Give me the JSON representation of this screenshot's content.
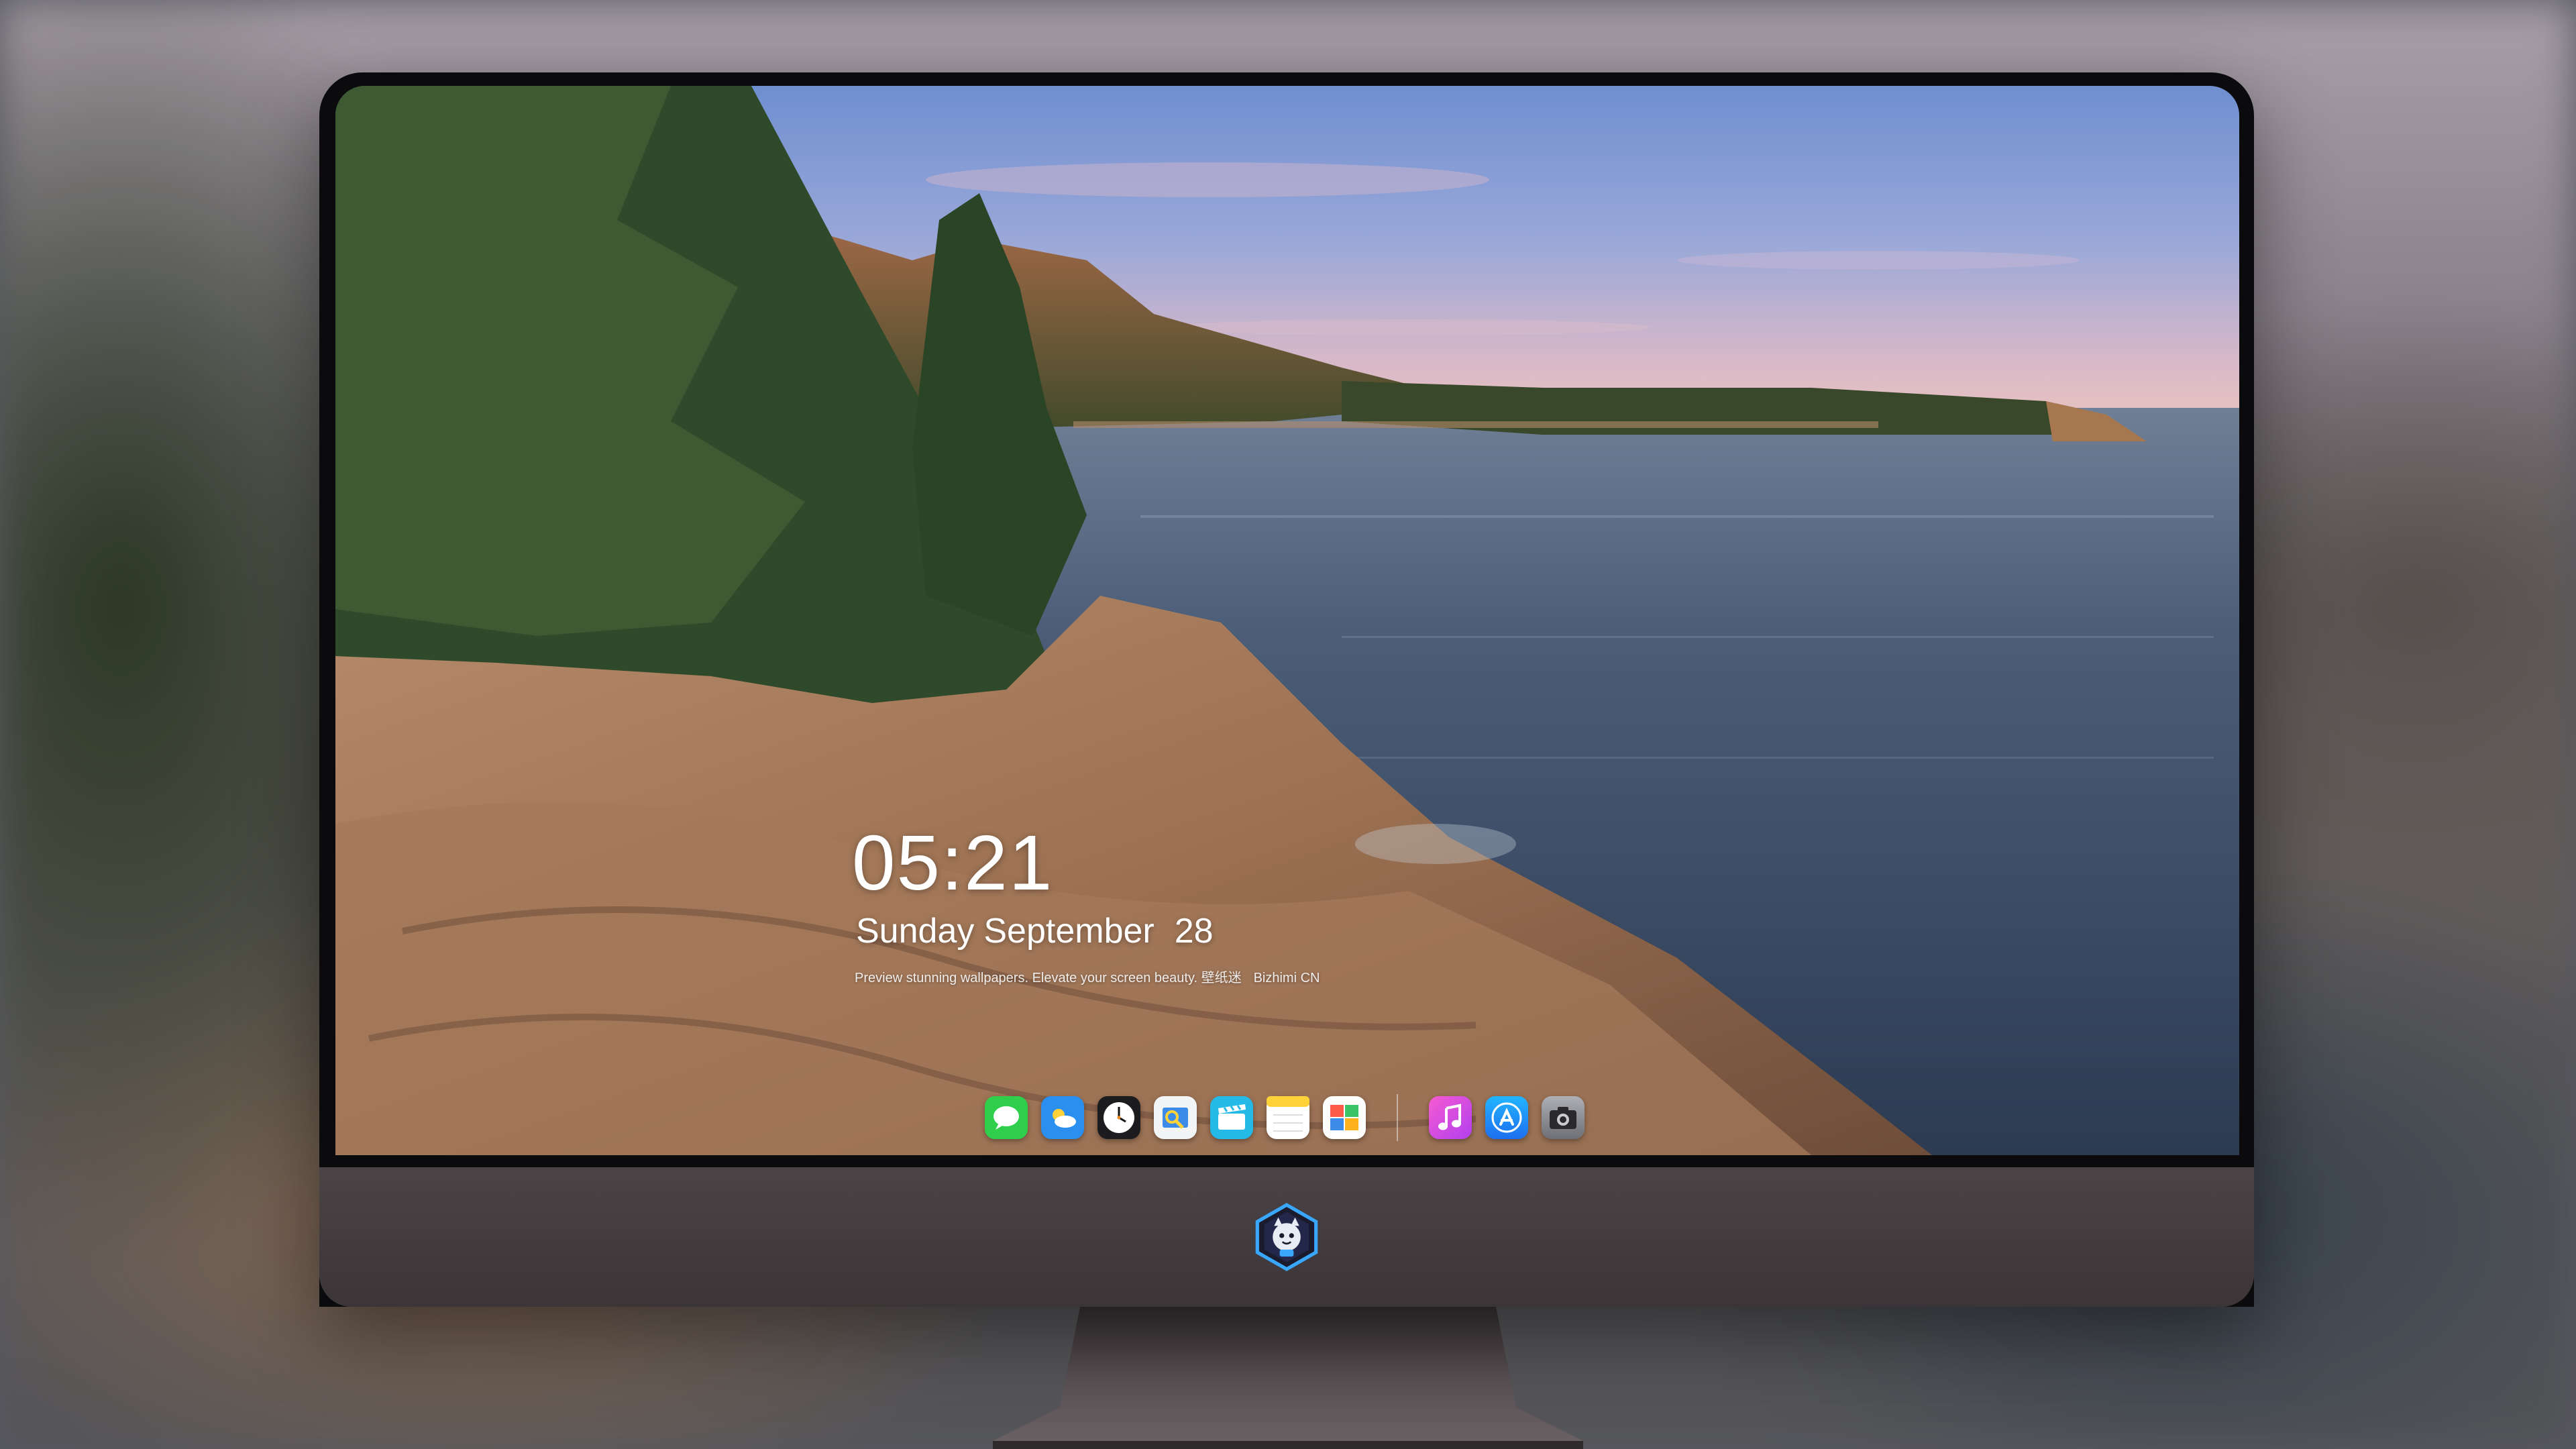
{
  "lock_screen": {
    "time": "05:21",
    "weekday": "Sunday",
    "month": "September",
    "day": "28",
    "caption": "Preview stunning wallpapers. Elevate your screen beauty. 壁纸迷",
    "credit": "Bizhimi CN"
  },
  "dock": {
    "apps": [
      {
        "name": "messages-icon",
        "color": "#2fcf4c"
      },
      {
        "name": "weather-icon",
        "color": "#2b8ff0"
      },
      {
        "name": "clock-icon",
        "color": "#1c1c1e"
      },
      {
        "name": "preview-icon",
        "color": "#f2f4f6"
      },
      {
        "name": "clips-icon",
        "color": "#25b9e8"
      },
      {
        "name": "notes-icon",
        "color": "#ffd23a"
      },
      {
        "name": "calendar-icon",
        "color": "#ffffff"
      },
      {
        "name": "music-icon",
        "color": "#e13cf0"
      },
      {
        "name": "app-store-icon",
        "color": "#1d8cf8"
      },
      {
        "name": "camera-icon",
        "color": "#8e8e93"
      }
    ]
  },
  "colors": {
    "bezel": "#0b0b0d",
    "chin": "#433d3f",
    "stand": "#5a5155"
  }
}
